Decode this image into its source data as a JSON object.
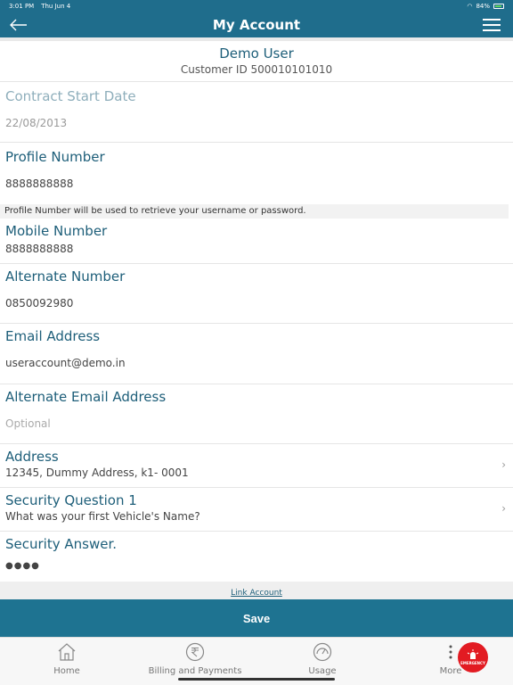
{
  "status": {
    "time": "3:01 PM",
    "date": "Thu Jun 4",
    "battery": "84%"
  },
  "nav": {
    "title": "My Account"
  },
  "account": {
    "name": "Demo User",
    "customer_id": "Customer ID 500010101010"
  },
  "fields": {
    "contract_start": {
      "label": "Contract Start Date",
      "value": "22/08/2013"
    },
    "profile_number": {
      "label": "Profile Number",
      "value": "8888888888"
    },
    "hint": "Profile Number will be used to retrieve your username or password.",
    "mobile_number": {
      "label": "Mobile Number",
      "value": "8888888888"
    },
    "alternate_number": {
      "label": "Alternate Number",
      "value": "0850092980"
    },
    "email": {
      "label": "Email Address",
      "value": "useraccount@demo.in"
    },
    "alt_email": {
      "label": "Alternate Email Address",
      "placeholder": "Optional"
    },
    "address": {
      "label": "Address",
      "value": "12345, Dummy Address, k1- 0001"
    },
    "security_question": {
      "label": "Security Question 1",
      "value": "What was your first Vehicle's Name?"
    },
    "security_answer": {
      "label": "Security Answer.",
      "value": "●●●●"
    }
  },
  "link_account": "Link Account",
  "save": "Save",
  "tabs": [
    {
      "label": "Home",
      "icon": "home-icon"
    },
    {
      "label": "Billing and Payments",
      "icon": "rupee-icon"
    },
    {
      "label": "Usage",
      "icon": "gauge-icon"
    },
    {
      "label": "More",
      "icon": "more-icon"
    }
  ],
  "emergency": "EMERGENCY"
}
